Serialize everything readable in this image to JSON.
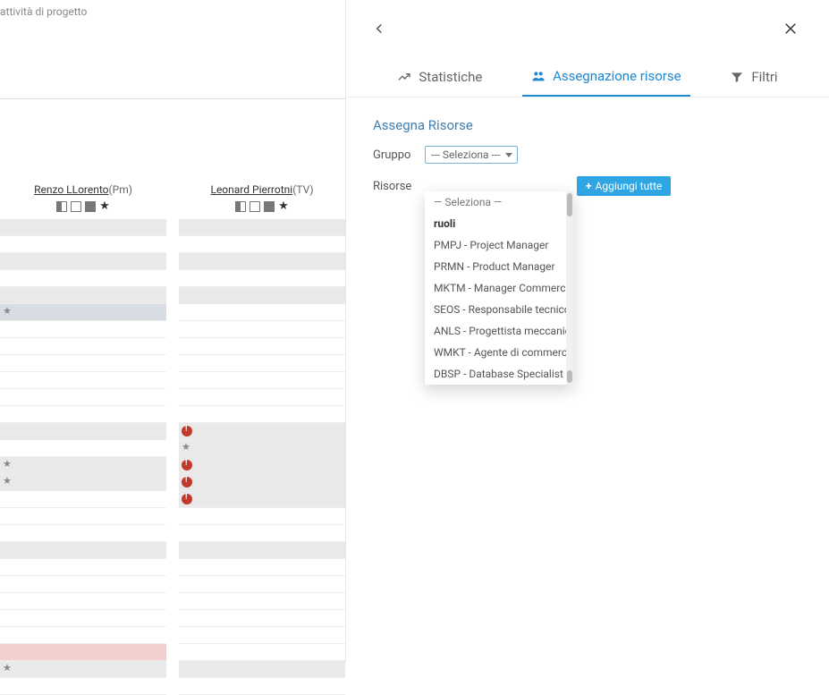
{
  "header": {
    "title": "attività di progetto"
  },
  "columns": [
    {
      "name": "Renzo LLorento",
      "code": "(Pm)"
    },
    {
      "name": "Leonard Pierrotni",
      "code": "(TV)"
    }
  ],
  "col0_rows": [
    {
      "k": "g"
    },
    {
      "k": "w"
    },
    {
      "k": "g"
    },
    {
      "k": "w"
    },
    {
      "k": "g"
    },
    {
      "k": "b",
      "star": true
    },
    {
      "k": "w"
    },
    {
      "k": "w"
    },
    {
      "k": "w"
    },
    {
      "k": "w"
    },
    {
      "k": "w"
    },
    {
      "k": "w"
    },
    {
      "k": "g"
    },
    {
      "k": "w"
    },
    {
      "k": "g",
      "star": true
    },
    {
      "k": "g",
      "star": true
    },
    {
      "k": "w"
    },
    {
      "k": "w"
    },
    {
      "k": "w"
    },
    {
      "k": "g"
    },
    {
      "k": "w"
    },
    {
      "k": "w"
    },
    {
      "k": "w"
    },
    {
      "k": "w"
    },
    {
      "k": "w"
    },
    {
      "k": "p"
    },
    {
      "k": "g",
      "star": true
    },
    {
      "k": "w"
    }
  ],
  "col1_rows": [
    {
      "k": "g"
    },
    {
      "k": "w"
    },
    {
      "k": "g"
    },
    {
      "k": "w"
    },
    {
      "k": "g"
    },
    {
      "k": "w"
    },
    {
      "k": "w"
    },
    {
      "k": "w"
    },
    {
      "k": "w"
    },
    {
      "k": "w"
    },
    {
      "k": "w"
    },
    {
      "k": "w"
    },
    {
      "k": "g",
      "warn": true
    },
    {
      "k": "g",
      "star": true
    },
    {
      "k": "g",
      "warn": true
    },
    {
      "k": "g",
      "warn": true
    },
    {
      "k": "g",
      "warn": true
    },
    {
      "k": "w"
    },
    {
      "k": "w"
    },
    {
      "k": "g"
    },
    {
      "k": "w"
    },
    {
      "k": "w"
    },
    {
      "k": "w"
    },
    {
      "k": "w"
    },
    {
      "k": "w"
    },
    {
      "k": "w"
    },
    {
      "k": "g"
    },
    {
      "k": "w"
    }
  ],
  "panel": {
    "tabs": {
      "stats": "Statistiche",
      "assign": "Assegnazione risorse",
      "filters": "Filtri"
    },
    "section_title": "Assegna Risorse",
    "group_label": "Gruppo",
    "resources_label": "Risorse",
    "select_placeholder": "--- Seleziona ---",
    "add_all": "Aggiungi tutte"
  },
  "dropdown": {
    "placeholder": "— Seleziona —",
    "group_header": "ruoli",
    "options": [
      "PMPJ - Project Manager",
      "PRMN - Product Manager",
      "MKTM - Manager Commerciale",
      "SEOS - Responsabile tecnico",
      "ANLS - Progettista meccanico",
      "WMKT - Agente di commercio",
      "DBSP - Database Specialist"
    ]
  }
}
